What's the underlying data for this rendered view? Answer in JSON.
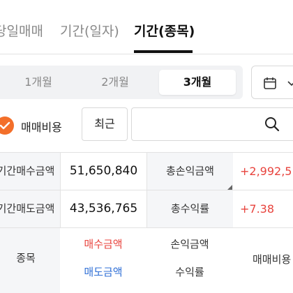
{
  "tabs": [
    {
      "label": "당일매매"
    },
    {
      "label": "기간(일자)"
    },
    {
      "label": "기간(종목)"
    }
  ],
  "period": {
    "options": [
      "1개월",
      "2개월",
      "3개월"
    ],
    "selected": "3개월"
  },
  "calendar": {
    "icon": "calendar-icon"
  },
  "filter": {
    "fee_checkbox_label": "매매비용",
    "fee_checked": true,
    "sort_select": "최근",
    "search_placeholder": ""
  },
  "summary": {
    "rows": [
      {
        "label1": "기간매수금액",
        "value1": "51,650,840",
        "label2": "총손익금액",
        "value2": "+2,992,5"
      },
      {
        "label1": "기간매도금액",
        "value1": "43,536,765",
        "label2": "총수익률",
        "value2": "+7.38"
      }
    ]
  },
  "table_header": {
    "stock": "종목",
    "buy_amount": "매수금액",
    "sell_amount": "매도금액",
    "pnl_amount": "손익금액",
    "return_rate": "수익률",
    "fee": "매매비용"
  },
  "colors": {
    "accent_orange": "#f36f2a",
    "profit_red": "#e8433d",
    "sell_blue": "#2f6fd6"
  }
}
